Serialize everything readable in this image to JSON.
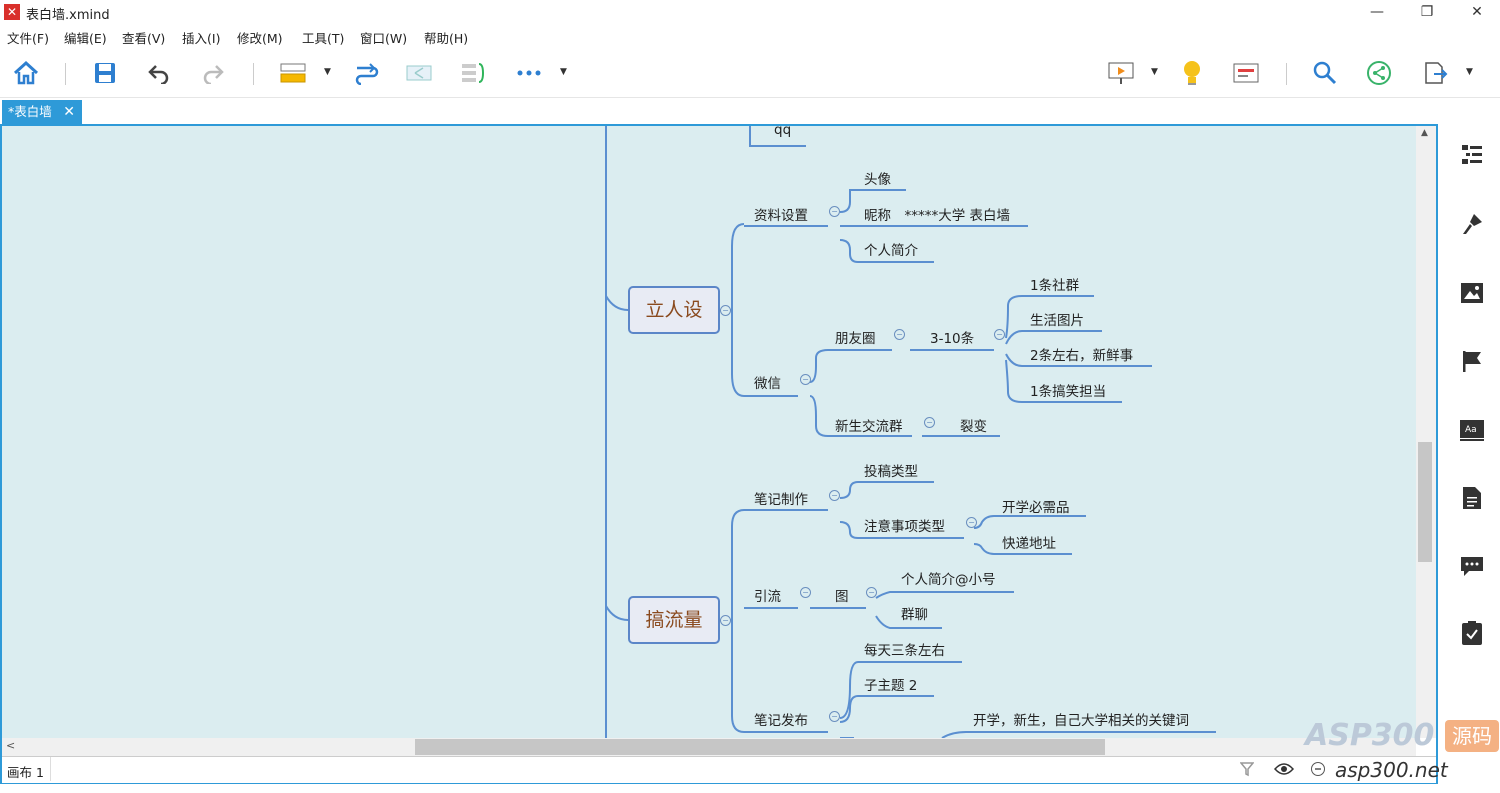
{
  "window": {
    "title": "表白墙.xmind",
    "minimize": "—",
    "restore": "❐",
    "close": "✕"
  },
  "menu": [
    "文件(F)",
    "编辑(E)",
    "查看(V)",
    "插入(I)",
    "修改(M)",
    "工具(T)",
    "窗口(W)",
    "帮助(H)"
  ],
  "tab": {
    "label": "*表白墙",
    "close": "✕"
  },
  "sheet": {
    "label": "画布 1"
  },
  "mindmap": {
    "qq": "qq",
    "branch1": {
      "title": "立人设",
      "profile": {
        "label": "资料设置",
        "children": [
          "头像",
          "昵称　*****大学 表白墙",
          "个人简介"
        ]
      },
      "wechat": {
        "label": "微信",
        "moments": {
          "label": "朋友圈",
          "freq": "3-10条",
          "children": [
            "1条社群",
            "生活图片",
            "2条左右，新鲜事",
            "1条搞笑担当"
          ]
        },
        "group": {
          "label": "新生交流群",
          "child": "裂变"
        }
      }
    },
    "branch2": {
      "title": "搞流量",
      "notes": {
        "label": "笔记制作",
        "types": [
          "投稿类型",
          "注意事项类型"
        ],
        "sub": [
          "开学必需品",
          "快递地址"
        ]
      },
      "traffic": {
        "label": "引流",
        "pic": "图",
        "children": [
          "个人简介@小号",
          "群聊"
        ]
      },
      "publish": {
        "label": "笔记发布",
        "children": [
          "每天三条左右",
          "子主题 2",
          "开学，新生，自己大学相关的关键词"
        ]
      }
    }
  },
  "watermark": {
    "main": "ASP300",
    "badge": "源码",
    "sub": "asp300.net"
  }
}
